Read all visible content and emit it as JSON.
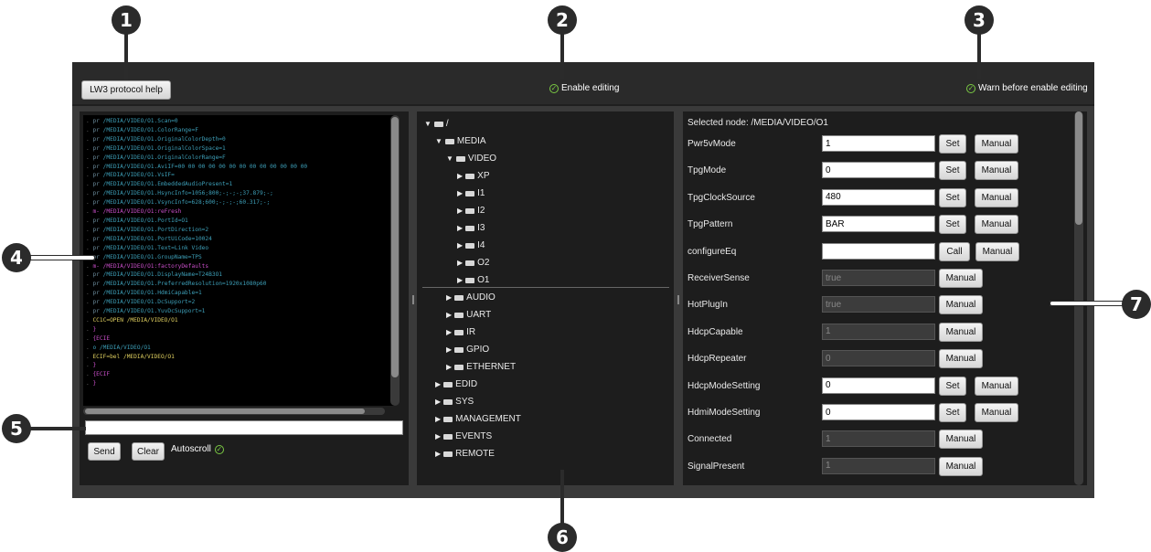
{
  "callouts": [
    "1",
    "2",
    "3",
    "4",
    "5",
    "6",
    "7"
  ],
  "toolbar": {
    "help_label": "LW3 protocol help",
    "enable_editing": "Enable editing",
    "warn_before": "Warn before enable editing"
  },
  "terminal": {
    "lines": [
      {
        "pfx": "pr",
        "path": "/MEDIA/VIDEO/O1.",
        "rest": "Scan=0"
      },
      {
        "pfx": "pr",
        "path": "/MEDIA/VIDEO/O1.",
        "rest": "ColorRange=F"
      },
      {
        "pfx": "pr",
        "path": "/MEDIA/VIDEO/O1.",
        "rest": "OriginalColorDepth=0"
      },
      {
        "pfx": "pr",
        "path": "/MEDIA/VIDEO/O1.",
        "rest": "OriginalColorSpace=1"
      },
      {
        "pfx": "pr",
        "path": "/MEDIA/VIDEO/O1.",
        "rest": "OriginalColorRange=F"
      },
      {
        "pfx": "pr",
        "path": "/MEDIA/VIDEO/O1.",
        "rest": "AviIF=00 00 00 00 00 00 00 00 00 00 00 00 00"
      },
      {
        "pfx": "pr",
        "path": "/MEDIA/VIDEO/O1.",
        "rest": "VsIF="
      },
      {
        "pfx": "pr",
        "path": "/MEDIA/VIDEO/O1.",
        "rest": "EmbeddedAudioPresent=1"
      },
      {
        "pfx": "pr",
        "path": "/MEDIA/VIDEO/O1.",
        "rest": "HsyncInfo=1056;800;-;-;-;37.879;-;"
      },
      {
        "pfx": "pr",
        "path": "/MEDIA/VIDEO/O1.",
        "rest": "VsyncInfo=628;600;-;-;-;60.317;-;"
      },
      {
        "pfx": "m-",
        "path": "/MEDIA/VIDEO/O1:",
        "rest": "reFresh"
      },
      {
        "pfx": "pr",
        "path": "/MEDIA/VIDEO/O1.",
        "rest": "PortId=O1"
      },
      {
        "pfx": "pr",
        "path": "/MEDIA/VIDEO/O1.",
        "rest": "PortDirection=2"
      },
      {
        "pfx": "pr",
        "path": "/MEDIA/VIDEO/O1.",
        "rest": "PortUiCode=10024"
      },
      {
        "pfx": "pr",
        "path": "/MEDIA/VIDEO/O1.",
        "rest": "Text=Link Video"
      },
      {
        "pfx": "pr",
        "path": "/MEDIA/VIDEO/O1.",
        "rest": "GroupName=TPS"
      },
      {
        "pfx": "m-",
        "path": "/MEDIA/VIDEO/O1:",
        "rest": "factoryDefaults"
      },
      {
        "pfx": "pr",
        "path": "/MEDIA/VIDEO/O1.",
        "rest": "DisplayName=T24B3O1"
      },
      {
        "pfx": "pr",
        "path": "/MEDIA/VIDEO/O1.",
        "rest": "PreferredResolution=1920x1080p60"
      },
      {
        "pfx": "pr",
        "path": "/MEDIA/VIDEO/O1.",
        "rest": "HdmiCapable=1"
      },
      {
        "pfx": "pr",
        "path": "/MEDIA/VIDEO/O1.",
        "rest": "DcSupport=2"
      },
      {
        "pfx": "pr",
        "path": "/MEDIA/VIDEO/O1.",
        "rest": "YuvDcSupport=1"
      }
    ],
    "cmd1": "CC1C=OPEN /MEDIA/VIDEO/O1",
    "brace_close": "}",
    "ecie": "{ECIE",
    "o_line": "o  /MEDIA/VIDEO/O1",
    "eci_line": "ECIF=bel /MEDIA/VIDEO/O1",
    "brace_close2": "}",
    "ecif": "{ECIF",
    "brace_close3": "}"
  },
  "command_input": {
    "value": "",
    "placeholder": ""
  },
  "console_controls": {
    "send": "Send",
    "clear": "Clear",
    "autoscroll": "Autoscroll"
  },
  "tree": {
    "root": "/",
    "media": "MEDIA",
    "video": "VIDEO",
    "video_children": [
      "XP",
      "I1",
      "I2",
      "I3",
      "I4",
      "O2",
      "O1"
    ],
    "media_children": [
      "AUDIO",
      "UART",
      "IR",
      "GPIO",
      "ETHERNET"
    ],
    "top_level": [
      "EDID",
      "SYS",
      "MANAGEMENT",
      "EVENTS",
      "REMOTE"
    ]
  },
  "props": {
    "selected": "Selected node: /MEDIA/VIDEO/O1",
    "set_label": "Set",
    "manual_label": "Manual",
    "call_label": "Call",
    "rows": [
      {
        "name": "Pwr5vMode",
        "value": "1",
        "ro": false,
        "action": "Set"
      },
      {
        "name": "TpgMode",
        "value": "0",
        "ro": false,
        "action": "Set"
      },
      {
        "name": "TpgClockSource",
        "value": "480",
        "ro": false,
        "action": "Set"
      },
      {
        "name": "TpgPattern",
        "value": "BAR",
        "ro": false,
        "action": "Set"
      },
      {
        "name": "configureEq",
        "value": "",
        "ro": false,
        "action": "Call"
      },
      {
        "name": "ReceiverSense",
        "value": "true",
        "ro": true,
        "action": ""
      },
      {
        "name": "HotPlugIn",
        "value": "true",
        "ro": true,
        "action": ""
      },
      {
        "name": "HdcpCapable",
        "value": "1",
        "ro": true,
        "action": ""
      },
      {
        "name": "HdcpRepeater",
        "value": "0",
        "ro": true,
        "action": ""
      },
      {
        "name": "HdcpModeSetting",
        "value": "0",
        "ro": false,
        "action": "Set"
      },
      {
        "name": "HdmiModeSetting",
        "value": "0",
        "ro": false,
        "action": "Set"
      },
      {
        "name": "Connected",
        "value": "1",
        "ro": true,
        "action": ""
      },
      {
        "name": "SignalPresent",
        "value": "1",
        "ro": true,
        "action": ""
      }
    ]
  },
  "colors": {
    "background": "#3a3a3a",
    "panel": "#1d1d1d",
    "accent_green": "#7ac943",
    "callout": "#2b2b2b"
  }
}
